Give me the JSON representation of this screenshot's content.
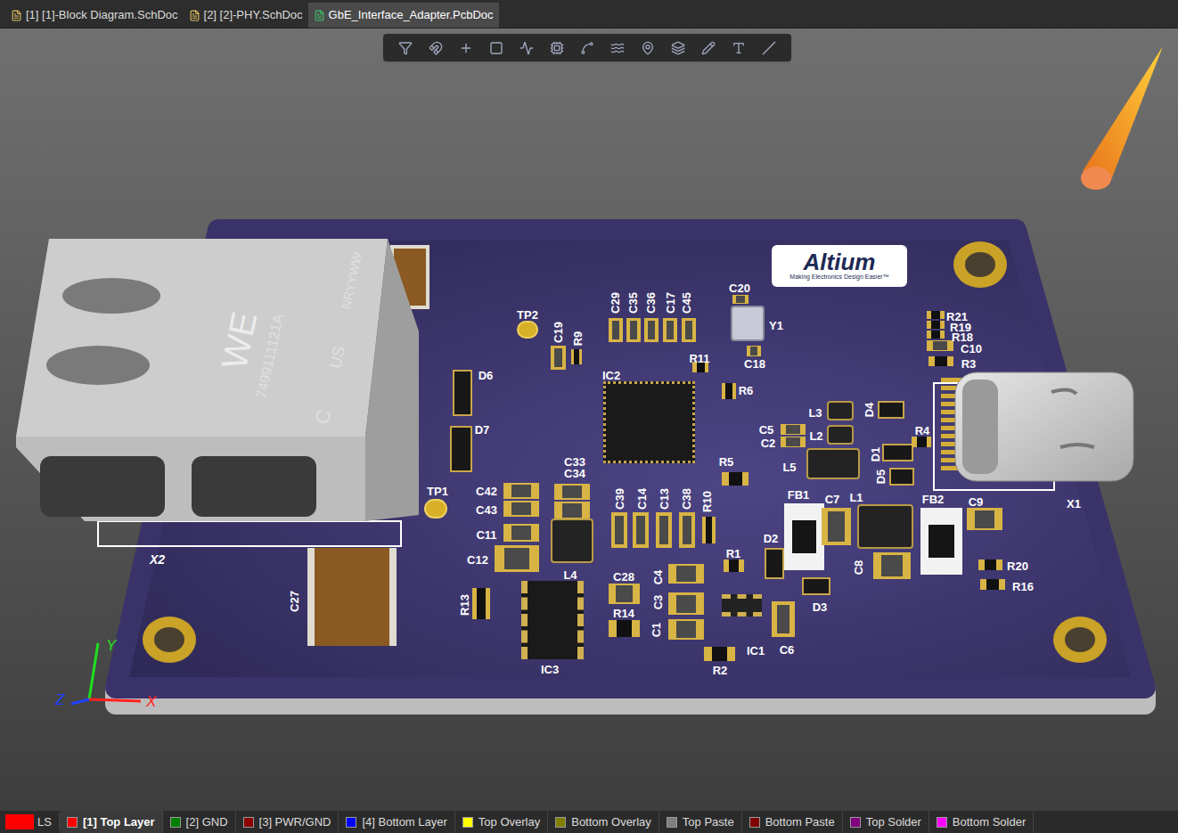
{
  "tabs": [
    {
      "label": "[1] [1]-Block Diagram.SchDoc",
      "selected": false,
      "kind": "sch"
    },
    {
      "label": "[2] [2]-PHY.SchDoc",
      "selected": false,
      "kind": "sch"
    },
    {
      "label": "GbE_Interface_Adapter.PcbDoc",
      "selected": true,
      "kind": "pcb"
    }
  ],
  "board": {
    "logo": {
      "name": "Altium",
      "tagline": "Making Electronics Design Easier™"
    },
    "rj45": {
      "designator": "X2",
      "brand": "WE",
      "part": "7499111121A",
      "date_code": "NRYYWW",
      "cert_c": "C",
      "cert_us": "US"
    },
    "usb": {
      "designator": "X1"
    },
    "components": [
      {
        "label": "C29",
        "kind": "cap"
      },
      {
        "label": "C35",
        "kind": "cap"
      },
      {
        "label": "C36",
        "kind": "cap"
      },
      {
        "label": "C17",
        "kind": "cap"
      },
      {
        "label": "C45",
        "kind": "cap"
      },
      {
        "label": "C20",
        "kind": "cap"
      },
      {
        "label": "Y1",
        "kind": "crystal"
      },
      {
        "label": "C18",
        "kind": "cap"
      },
      {
        "label": "TP2",
        "kind": "testpoint"
      },
      {
        "label": "C19",
        "kind": "cap"
      },
      {
        "label": "R9",
        "kind": "res"
      },
      {
        "label": "R11",
        "kind": "res"
      },
      {
        "label": "IC2",
        "kind": "qfn"
      },
      {
        "label": "R6",
        "kind": "res"
      },
      {
        "label": "D6",
        "kind": "diode"
      },
      {
        "label": "D7",
        "kind": "diode"
      },
      {
        "label": "TP1",
        "kind": "testpoint"
      },
      {
        "label": "C33",
        "kind": "cap"
      },
      {
        "label": "C34",
        "kind": "cap"
      },
      {
        "label": "C42",
        "kind": "cap"
      },
      {
        "label": "C43",
        "kind": "cap"
      },
      {
        "label": "C11",
        "kind": "cap"
      },
      {
        "label": "C12",
        "kind": "cap"
      },
      {
        "label": "L4",
        "kind": "inductor"
      },
      {
        "label": "C39",
        "kind": "cap"
      },
      {
        "label": "C14",
        "kind": "cap"
      },
      {
        "label": "C13",
        "kind": "cap"
      },
      {
        "label": "C38",
        "kind": "cap"
      },
      {
        "label": "R10",
        "kind": "res"
      },
      {
        "label": "R5",
        "kind": "res"
      },
      {
        "label": "L3",
        "kind": "inductor"
      },
      {
        "label": "D4",
        "kind": "diode"
      },
      {
        "label": "C5",
        "kind": "cap"
      },
      {
        "label": "C2",
        "kind": "cap"
      },
      {
        "label": "L2",
        "kind": "inductor"
      },
      {
        "label": "L5",
        "kind": "inductor"
      },
      {
        "label": "D1",
        "kind": "diode"
      },
      {
        "label": "D5",
        "kind": "diode"
      },
      {
        "label": "R4",
        "kind": "res"
      },
      {
        "label": "R21",
        "kind": "res"
      },
      {
        "label": "R19",
        "kind": "res"
      },
      {
        "label": "R18",
        "kind": "res"
      },
      {
        "label": "C10",
        "kind": "cap"
      },
      {
        "label": "R3",
        "kind": "res"
      },
      {
        "label": "FB1",
        "kind": "ferrite"
      },
      {
        "label": "C7",
        "kind": "cap"
      },
      {
        "label": "L1",
        "kind": "inductor"
      },
      {
        "label": "C8",
        "kind": "cap"
      },
      {
        "label": "FB2",
        "kind": "ferrite"
      },
      {
        "label": "C9",
        "kind": "cap"
      },
      {
        "label": "D2",
        "kind": "diode"
      },
      {
        "label": "D3",
        "kind": "diode"
      },
      {
        "label": "R1",
        "kind": "res"
      },
      {
        "label": "C4",
        "kind": "cap"
      },
      {
        "label": "C3",
        "kind": "cap"
      },
      {
        "label": "C1",
        "kind": "cap"
      },
      {
        "label": "C28",
        "kind": "cap"
      },
      {
        "label": "R14",
        "kind": "res"
      },
      {
        "label": "IC1",
        "kind": "sot"
      },
      {
        "label": "C6",
        "kind": "cap"
      },
      {
        "label": "R2",
        "kind": "res"
      },
      {
        "label": "R13",
        "kind": "res"
      },
      {
        "label": "IC3",
        "kind": "soic"
      },
      {
        "label": "C27",
        "kind": "tantalum"
      },
      {
        "label": "R20",
        "kind": "res"
      },
      {
        "label": "R16",
        "kind": "res"
      }
    ]
  },
  "axes": [
    {
      "label": "X",
      "color": "#ff2020"
    },
    {
      "label": "Y",
      "color": "#20e020"
    },
    {
      "label": "Z",
      "color": "#2040ff"
    }
  ],
  "layer_bar": {
    "ls": "LS",
    "layers": [
      {
        "label": "[1] Top Layer",
        "color": "#ff0000",
        "selected": true
      },
      {
        "label": "[2] GND",
        "color": "#008000",
        "selected": false
      },
      {
        "label": "[3] PWR/GND",
        "color": "#8b0000",
        "selected": false
      },
      {
        "label": "[4] Bottom Layer",
        "color": "#0000ff",
        "selected": false
      },
      {
        "label": "Top Overlay",
        "color": "#ffff00",
        "selected": false
      },
      {
        "label": "Bottom Overlay",
        "color": "#808000",
        "selected": false
      },
      {
        "label": "Top Paste",
        "color": "#808080",
        "selected": false
      },
      {
        "label": "Bottom Paste",
        "color": "#800000",
        "selected": false
      },
      {
        "label": "Top Solder",
        "color": "#800080",
        "selected": false
      },
      {
        "label": "Bottom Solder",
        "color": "#ff00ff",
        "selected": false
      }
    ]
  }
}
